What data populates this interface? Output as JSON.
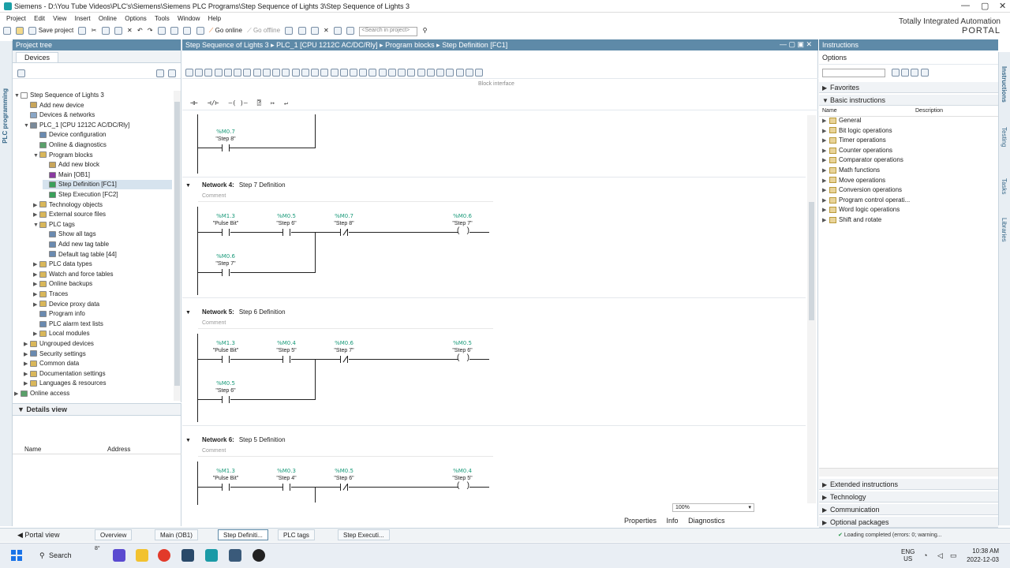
{
  "window": {
    "title": "Siemens  -  D:\\You Tube Videos\\PLC's\\Siemens\\Siemens PLC Programs\\Step Sequence of Lights 3\\Step Sequence of Lights 3",
    "brand_line1": "Totally Integrated Automation",
    "brand_line2": "PORTAL"
  },
  "menu": [
    "Project",
    "Edit",
    "View",
    "Insert",
    "Online",
    "Options",
    "Tools",
    "Window",
    "Help"
  ],
  "toolbar": {
    "save_label": "Save project",
    "go_online": "Go online",
    "go_offline": "Go offline",
    "search_placeholder": "<Search in project>"
  },
  "left_strip_label": "PLC programming",
  "project_tree": {
    "header": "Project tree",
    "tab": "Devices",
    "items": [
      {
        "label": "Step Sequence of Lights 3",
        "indent": 0,
        "tw": "▼",
        "color": "#ffffff"
      },
      {
        "label": "Add new device",
        "indent": 1,
        "tw": "",
        "color": "#c8a55a"
      },
      {
        "label": "Devices & networks",
        "indent": 1,
        "tw": "",
        "color": "#8aa6c6"
      },
      {
        "label": "PLC_1 [CPU 1212C AC/DC/Rly]",
        "indent": 1,
        "tw": "▼",
        "color": "#7a8a9a"
      },
      {
        "label": "Device configuration",
        "indent": 2,
        "tw": "",
        "color": "#6a8ab0"
      },
      {
        "label": "Online & diagnostics",
        "indent": 2,
        "tw": "",
        "color": "#5aa06a"
      },
      {
        "label": "Program blocks",
        "indent": 2,
        "tw": "▼",
        "color": "#d9b75a"
      },
      {
        "label": "Add new block",
        "indent": 3,
        "tw": "",
        "color": "#c8a55a"
      },
      {
        "label": "Main [OB1]",
        "indent": 3,
        "tw": "",
        "color": "#8a3aa0"
      },
      {
        "label": "Step Definition [FC1]",
        "indent": 3,
        "tw": "",
        "color": "#3aa05a",
        "selected": true
      },
      {
        "label": "Step Execution [FC2]",
        "indent": 3,
        "tw": "",
        "color": "#3aa05a"
      },
      {
        "label": "Technology objects",
        "indent": 2,
        "tw": "▶",
        "color": "#d9b75a"
      },
      {
        "label": "External source files",
        "indent": 2,
        "tw": "▶",
        "color": "#d9b75a"
      },
      {
        "label": "PLC tags",
        "indent": 2,
        "tw": "▼",
        "color": "#d9b75a"
      },
      {
        "label": "Show all tags",
        "indent": 3,
        "tw": "",
        "color": "#6a8ab0"
      },
      {
        "label": "Add new tag table",
        "indent": 3,
        "tw": "",
        "color": "#6a8ab0"
      },
      {
        "label": "Default tag table [44]",
        "indent": 3,
        "tw": "",
        "color": "#6a8ab0"
      },
      {
        "label": "PLC data types",
        "indent": 2,
        "tw": "▶",
        "color": "#d9b75a"
      },
      {
        "label": "Watch and force tables",
        "indent": 2,
        "tw": "▶",
        "color": "#d9b75a"
      },
      {
        "label": "Online backups",
        "indent": 2,
        "tw": "▶",
        "color": "#d9b75a"
      },
      {
        "label": "Traces",
        "indent": 2,
        "tw": "▶",
        "color": "#d9b75a"
      },
      {
        "label": "Device proxy data",
        "indent": 2,
        "tw": "▶",
        "color": "#d9b75a"
      },
      {
        "label": "Program info",
        "indent": 2,
        "tw": "",
        "color": "#6a8ab0"
      },
      {
        "label": "PLC alarm text lists",
        "indent": 2,
        "tw": "",
        "color": "#6a8ab0"
      },
      {
        "label": "Local modules",
        "indent": 2,
        "tw": "▶",
        "color": "#d9b75a"
      },
      {
        "label": "Ungrouped devices",
        "indent": 1,
        "tw": "▶",
        "color": "#d9b75a"
      },
      {
        "label": "Security settings",
        "indent": 1,
        "tw": "▶",
        "color": "#6a8ab0"
      },
      {
        "label": "Common data",
        "indent": 1,
        "tw": "▶",
        "color": "#d9b75a"
      },
      {
        "label": "Documentation settings",
        "indent": 1,
        "tw": "▶",
        "color": "#d9b75a"
      },
      {
        "label": "Languages & resources",
        "indent": 1,
        "tw": "▶",
        "color": "#d9b75a"
      },
      {
        "label": "Online access",
        "indent": 0,
        "tw": "▶",
        "color": "#5aa06a"
      }
    ]
  },
  "details": {
    "header": "Details view",
    "col_name": "Name",
    "col_address": "Address"
  },
  "editor": {
    "breadcrumb": "Step Sequence of Lights 3  ▸  PLC_1 [CPU 1212C AC/DC/Rly]  ▸  Program blocks  ▸  Step Definition [FC1]",
    "block_interface": "Block interface",
    "ladder_tools": [
      "⊣⊢",
      "⊣/⊢",
      "–( )–",
      "⍰",
      "↦",
      "↵"
    ],
    "zoom": "100%",
    "comment_label": "Comment",
    "partial_top": {
      "addr": "%M0.7",
      "sym": "\"Step 8\""
    },
    "networks": [
      {
        "title": "Network 4:",
        "desc": "Step 7 Definition",
        "contacts": [
          {
            "addr": "%M1.3",
            "sym": "\"Pulse Bit\"",
            "nc": false
          },
          {
            "addr": "%M0.5",
            "sym": "\"Step 6\"",
            "nc": false
          },
          {
            "addr": "%M0.7",
            "sym": "\"Step 8\"",
            "nc": true
          }
        ],
        "coil": {
          "addr": "%M0.6",
          "sym": "\"Step 7\""
        },
        "latch": {
          "addr": "%M0.6",
          "sym": "\"Step 7\""
        }
      },
      {
        "title": "Network 5:",
        "desc": "Step 6 Definition",
        "contacts": [
          {
            "addr": "%M1.3",
            "sym": "\"Pulse Bit\"",
            "nc": false
          },
          {
            "addr": "%M0.4",
            "sym": "\"Step 5\"",
            "nc": false
          },
          {
            "addr": "%M0.6",
            "sym": "\"Step 7\"",
            "nc": true
          }
        ],
        "coil": {
          "addr": "%M0.5",
          "sym": "\"Step 6\""
        },
        "latch": {
          "addr": "%M0.5",
          "sym": "\"Step 6\""
        }
      },
      {
        "title": "Network 6:",
        "desc": "Step 5 Definition",
        "contacts": [
          {
            "addr": "%M1.3",
            "sym": "\"Pulse Bit\"",
            "nc": false
          },
          {
            "addr": "%M0.3",
            "sym": "\"Step 4\"",
            "nc": false
          },
          {
            "addr": "%M0.5",
            "sym": "\"Step 6\"",
            "nc": true
          }
        ],
        "coil": {
          "addr": "%M0.4",
          "sym": "\"Step 5\""
        },
        "latch": null
      }
    ]
  },
  "instructions": {
    "header": "Instructions",
    "options": "Options",
    "favorites": "Favorites",
    "basic": "Basic instructions",
    "col_name": "Name",
    "col_desc": "Description",
    "items": [
      "General",
      "Bit logic operations",
      "Timer operations",
      "Counter operations",
      "Comparator operations",
      "Math functions",
      "Move operations",
      "Conversion operations",
      "Program control operati...",
      "Word logic operations",
      "Shift and rotate"
    ],
    "extended": "Extended instructions",
    "technology": "Technology",
    "communication": "Communication",
    "optional": "Optional packages"
  },
  "right_strip": [
    "Instructions",
    "Testing",
    "Tasks",
    "Libraries"
  ],
  "inspector": {
    "properties": "Properties",
    "info": "Info",
    "diagnostics": "Diagnostics"
  },
  "status_tabs": {
    "portal": "Portal view",
    "overview": "Overview",
    "main": "Main (OB1)",
    "stepdef": "Step Definiti...",
    "plctags": "PLC tags",
    "stepexec": "Step Executi..."
  },
  "status_msg": "Loading completed (errors: 0; warning...",
  "taskbar": {
    "search": "Search",
    "weather": "8°",
    "lang1": "ENG",
    "lang2": "US",
    "time": "10:38 AM",
    "date": "2022-12-03"
  }
}
